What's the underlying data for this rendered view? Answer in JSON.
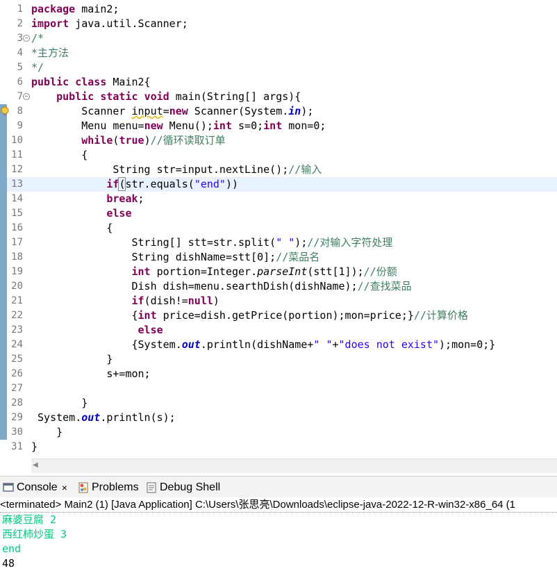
{
  "editor": {
    "lines": [
      {
        "n": "1",
        "fold": false,
        "warn": false,
        "current": false,
        "cov": false,
        "tokens": [
          {
            "c": "kw",
            "t": "package"
          },
          {
            "t": " main2;"
          }
        ]
      },
      {
        "n": "2",
        "fold": false,
        "warn": false,
        "current": false,
        "cov": false,
        "tokens": [
          {
            "c": "kw",
            "t": "import"
          },
          {
            "t": " java.util.Scanner;"
          }
        ]
      },
      {
        "n": "3",
        "fold": true,
        "warn": false,
        "current": false,
        "cov": false,
        "tokens": [
          {
            "c": "cm",
            "t": "/*"
          }
        ]
      },
      {
        "n": "4",
        "fold": false,
        "warn": false,
        "current": false,
        "cov": false,
        "tokens": [
          {
            "c": "cm",
            "t": "*主方法"
          }
        ]
      },
      {
        "n": "5",
        "fold": false,
        "warn": false,
        "current": false,
        "cov": false,
        "tokens": [
          {
            "c": "cm",
            "t": "*/"
          }
        ]
      },
      {
        "n": "6",
        "fold": false,
        "warn": false,
        "current": false,
        "cov": false,
        "tokens": [
          {
            "c": "kw",
            "t": "public"
          },
          {
            "t": " "
          },
          {
            "c": "kw",
            "t": "class"
          },
          {
            "t": " Main2{"
          }
        ]
      },
      {
        "n": "7",
        "fold": true,
        "warn": false,
        "current": false,
        "cov": false,
        "tokens": [
          {
            "t": "    "
          },
          {
            "c": "kw",
            "t": "public"
          },
          {
            "t": " "
          },
          {
            "c": "kw",
            "t": "static"
          },
          {
            "t": " "
          },
          {
            "c": "kw",
            "t": "void"
          },
          {
            "t": " main(String[] args){"
          }
        ]
      },
      {
        "n": "8",
        "fold": false,
        "warn": true,
        "current": false,
        "cov": true,
        "tokens": [
          {
            "t": "        Scanner "
          },
          {
            "c": "wavy",
            "t": "input"
          },
          {
            "t": "="
          },
          {
            "c": "kw",
            "t": "new"
          },
          {
            "t": " Scanner(System."
          },
          {
            "c": "fd",
            "t": "in"
          },
          {
            "t": ");"
          }
        ]
      },
      {
        "n": "9",
        "fold": false,
        "warn": false,
        "current": false,
        "cov": true,
        "tokens": [
          {
            "t": "        Menu menu="
          },
          {
            "c": "kw",
            "t": "new"
          },
          {
            "t": " Menu();"
          },
          {
            "c": "kw",
            "t": "int"
          },
          {
            "t": " s=0;"
          },
          {
            "c": "kw",
            "t": "int"
          },
          {
            "t": " mon=0;"
          }
        ]
      },
      {
        "n": "10",
        "fold": false,
        "warn": false,
        "current": false,
        "cov": true,
        "tokens": [
          {
            "t": "        "
          },
          {
            "c": "kw",
            "t": "while"
          },
          {
            "t": "("
          },
          {
            "c": "kw",
            "t": "true"
          },
          {
            "t": ")"
          },
          {
            "c": "cm",
            "t": "//循环读取订单"
          }
        ]
      },
      {
        "n": "11",
        "fold": false,
        "warn": false,
        "current": false,
        "cov": true,
        "tokens": [
          {
            "t": "        {"
          }
        ]
      },
      {
        "n": "12",
        "fold": false,
        "warn": false,
        "current": false,
        "cov": true,
        "tokens": [
          {
            "t": "             String str=input.nextLine();"
          },
          {
            "c": "cm",
            "t": "//输入"
          }
        ]
      },
      {
        "n": "13",
        "fold": false,
        "warn": false,
        "current": true,
        "cov": true,
        "tokens": [
          {
            "t": "            "
          },
          {
            "c": "kw",
            "t": "if"
          },
          {
            "c": "boxp",
            "t": "("
          },
          {
            "t": "str.equals("
          },
          {
            "c": "st",
            "t": "\"end\""
          },
          {
            "t": "))"
          }
        ]
      },
      {
        "n": "14",
        "fold": false,
        "warn": false,
        "current": false,
        "cov": true,
        "tokens": [
          {
            "t": "            "
          },
          {
            "c": "kw",
            "t": "break"
          },
          {
            "t": ";"
          }
        ]
      },
      {
        "n": "15",
        "fold": false,
        "warn": false,
        "current": false,
        "cov": true,
        "tokens": [
          {
            "t": "            "
          },
          {
            "c": "kw",
            "t": "else"
          }
        ]
      },
      {
        "n": "16",
        "fold": false,
        "warn": false,
        "current": false,
        "cov": true,
        "tokens": [
          {
            "t": "            {"
          }
        ]
      },
      {
        "n": "17",
        "fold": false,
        "warn": false,
        "current": false,
        "cov": true,
        "tokens": [
          {
            "t": "                String[] stt=str.split("
          },
          {
            "c": "st",
            "t": "\" \""
          },
          {
            "t": ");"
          },
          {
            "c": "cm",
            "t": "//对输入字符处理"
          }
        ]
      },
      {
        "n": "18",
        "fold": false,
        "warn": false,
        "current": false,
        "cov": true,
        "tokens": [
          {
            "t": "                String dishName=stt[0];"
          },
          {
            "c": "cm",
            "t": "//菜品名"
          }
        ]
      },
      {
        "n": "19",
        "fold": false,
        "warn": false,
        "current": false,
        "cov": true,
        "tokens": [
          {
            "t": "                "
          },
          {
            "c": "kw",
            "t": "int"
          },
          {
            "t": " portion=Integer."
          },
          {
            "c": "it",
            "t": "parseInt"
          },
          {
            "t": "(stt[1]);"
          },
          {
            "c": "cm",
            "t": "//份额"
          }
        ]
      },
      {
        "n": "20",
        "fold": false,
        "warn": false,
        "current": false,
        "cov": true,
        "tokens": [
          {
            "t": "                Dish dish=menu.searthDish(dishName);"
          },
          {
            "c": "cm",
            "t": "//查找菜品"
          }
        ]
      },
      {
        "n": "21",
        "fold": false,
        "warn": false,
        "current": false,
        "cov": true,
        "tokens": [
          {
            "t": "                "
          },
          {
            "c": "kw",
            "t": "if"
          },
          {
            "t": "(dish!="
          },
          {
            "c": "kw",
            "t": "null"
          },
          {
            "t": ")"
          }
        ]
      },
      {
        "n": "22",
        "fold": false,
        "warn": false,
        "current": false,
        "cov": true,
        "tokens": [
          {
            "t": "                {"
          },
          {
            "c": "kw",
            "t": "int"
          },
          {
            "t": " price=dish.getPrice(portion);mon=price;}"
          },
          {
            "c": "cm",
            "t": "//计算价格"
          }
        ]
      },
      {
        "n": "23",
        "fold": false,
        "warn": false,
        "current": false,
        "cov": true,
        "tokens": [
          {
            "t": "                 "
          },
          {
            "c": "kw",
            "t": "else"
          }
        ]
      },
      {
        "n": "24",
        "fold": false,
        "warn": false,
        "current": false,
        "cov": true,
        "tokens": [
          {
            "t": "                {System."
          },
          {
            "c": "fd",
            "t": "out"
          },
          {
            "t": ".println(dishName+"
          },
          {
            "c": "st",
            "t": "\" \""
          },
          {
            "t": "+"
          },
          {
            "c": "st",
            "t": "\"does not exist\""
          },
          {
            "t": ");mon=0;}"
          }
        ]
      },
      {
        "n": "25",
        "fold": false,
        "warn": false,
        "current": false,
        "cov": true,
        "tokens": [
          {
            "t": "            }"
          }
        ]
      },
      {
        "n": "26",
        "fold": false,
        "warn": false,
        "current": false,
        "cov": true,
        "tokens": [
          {
            "t": "            s+=mon;"
          }
        ]
      },
      {
        "n": "27",
        "fold": false,
        "warn": false,
        "current": false,
        "cov": true,
        "tokens": [
          {
            "t": ""
          }
        ]
      },
      {
        "n": "28",
        "fold": false,
        "warn": false,
        "current": false,
        "cov": true,
        "tokens": [
          {
            "t": "        }"
          }
        ]
      },
      {
        "n": "29",
        "fold": false,
        "warn": false,
        "current": false,
        "cov": true,
        "tokens": [
          {
            "t": " System."
          },
          {
            "c": "fd",
            "t": "out"
          },
          {
            "t": ".println(s);"
          }
        ]
      },
      {
        "n": "30",
        "fold": false,
        "warn": false,
        "current": false,
        "cov": true,
        "tokens": [
          {
            "t": "    }"
          }
        ]
      },
      {
        "n": "31",
        "fold": false,
        "warn": false,
        "current": false,
        "cov": false,
        "tokens": [
          {
            "t": "}"
          }
        ]
      }
    ]
  },
  "panel": {
    "tabs": [
      {
        "label": "Console",
        "icon": "console-icon",
        "close": "×",
        "active": true
      },
      {
        "label": "Problems",
        "icon": "problems-icon",
        "close": "",
        "active": false
      },
      {
        "label": "Debug Shell",
        "icon": "debug-shell-icon",
        "close": "",
        "active": false
      }
    ],
    "status": "<terminated> Main2 (1) [Java Application] C:\\Users\\张思亮\\Downloads\\eclipse-java-2022-12-R-win32-x86_64 (1",
    "output": [
      {
        "text": "麻婆豆腐 2",
        "color": "green"
      },
      {
        "text": "西红柿炒蛋 3",
        "color": "green"
      },
      {
        "text": "end",
        "color": "green"
      },
      {
        "text": "48",
        "color": "black"
      }
    ]
  },
  "colors": {
    "keyword": "#7f0055",
    "comment": "#3f7f5f",
    "string": "#2a00ff",
    "input": "#00c87d",
    "current_line": "#e8f2fe",
    "coverage": "#7ea8c8"
  }
}
